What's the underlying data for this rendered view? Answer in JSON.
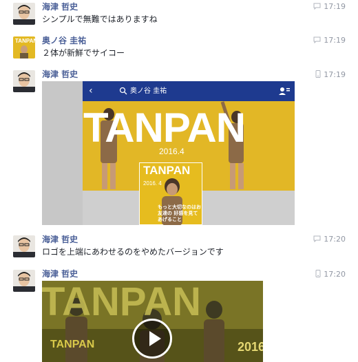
{
  "messages": [
    {
      "sender": "海津 哲史",
      "text": "シンプルで無難ではありますね",
      "time": "17:19",
      "time_icon": "chat-bubble-icon",
      "avatar": "person-avatar"
    },
    {
      "sender": "奥ノ谷 圭祐",
      "text": "２体が新鮮でサイコー",
      "time": "17:19",
      "time_icon": "chat-bubble-icon",
      "avatar": "magazine-avatar",
      "avatar_label": "TANPAN"
    },
    {
      "sender": "海津 哲史",
      "time": "17:19",
      "time_icon": "mobile-phone-icon",
      "avatar": "person-avatar",
      "attachment": {
        "type": "photo",
        "app_bar_title": "奥ノ谷 圭祐",
        "big_logo": "TANPAN",
        "issue_date": "2016.4",
        "magazine_title": "TANPAN",
        "magazine_issue": "2016. 4",
        "magazine_caption": "もっと大切なのはお友達の 好感を見てあげること"
      }
    },
    {
      "sender": "海津 哲史",
      "text": "ロゴを上端にあわせるのをやめたバージョンです",
      "time": "17:20",
      "time_icon": "chat-bubble-icon",
      "avatar": "person-avatar"
    },
    {
      "sender": "海津 哲史",
      "time": "17:20",
      "time_icon": "mobile-phone-icon",
      "avatar": "person-avatar",
      "attachment": {
        "type": "video",
        "big_logo": "TANPAN",
        "small_logo": "TANPAN",
        "year": "2016"
      }
    }
  ],
  "colors": {
    "sender_name": "#4a5f97",
    "message_text": "#1d2129",
    "timestamp": "#9197a3",
    "photo_app_bar": "#1e3a8f",
    "magazine_yellow": "#e6bc1f"
  }
}
